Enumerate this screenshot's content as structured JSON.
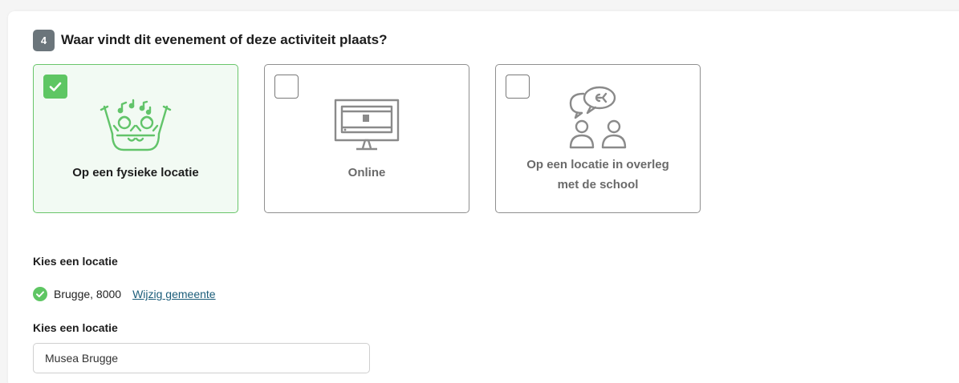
{
  "step": {
    "number": "4",
    "question": "Waar vindt dit evenement of deze activiteit plaats?"
  },
  "options": [
    {
      "label": "Op een fysieke locatie",
      "selected": true,
      "icon": "cheering-crowd-icon"
    },
    {
      "label": "Online",
      "selected": false,
      "icon": "monitor-video-icon"
    },
    {
      "label_line1": "Op een locatie in overleg",
      "label_line2": "met de school",
      "selected": false,
      "icon": "people-chat-icon"
    }
  ],
  "location": {
    "section_label": "Kies een locatie",
    "chosen_city": "Brugge, 8000",
    "change_link": "Wijzig gemeente"
  },
  "venue": {
    "section_label": "Kies een locatie",
    "value": "Musea Brugge"
  },
  "colors": {
    "accent_green": "#5ec663",
    "selected_bg": "#f2faf3",
    "link": "#1b5d7a",
    "badge": "#6b757b"
  }
}
